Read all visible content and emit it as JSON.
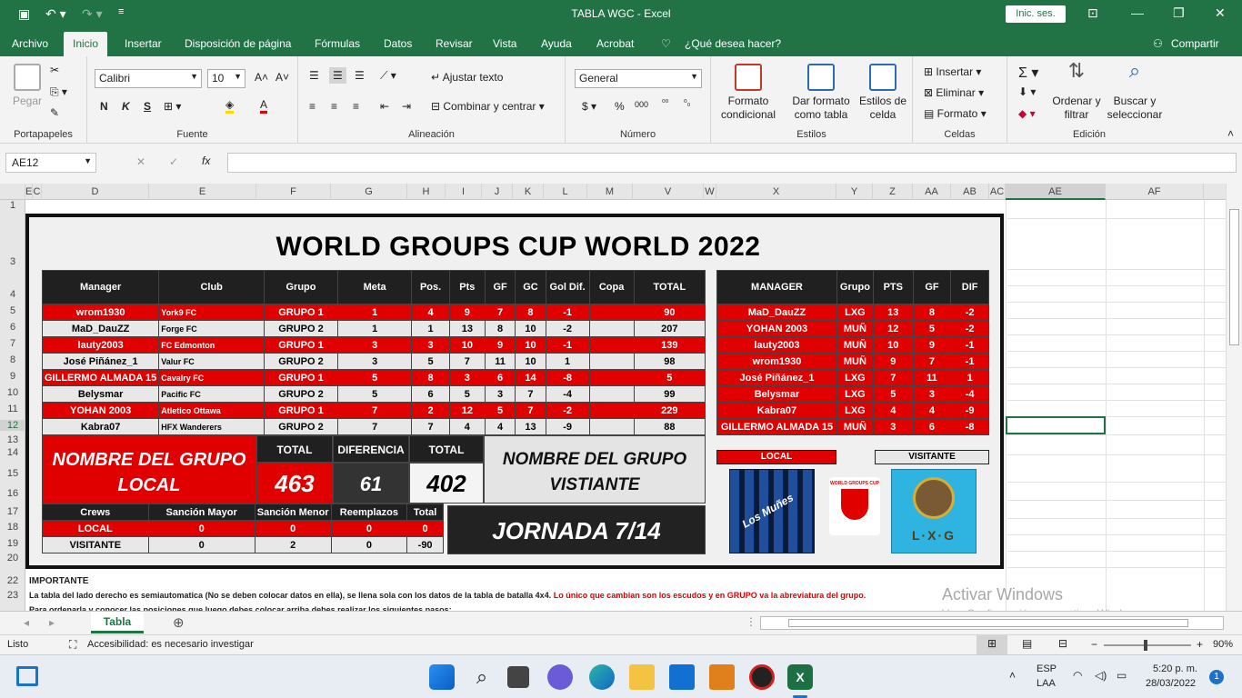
{
  "window": {
    "title": "TABLA WGC  -  Excel",
    "signin": "Inic. ses."
  },
  "menu": [
    "Archivo",
    "Inicio",
    "Insertar",
    "Disposición de página",
    "Fórmulas",
    "Datos",
    "Revisar",
    "Vista",
    "Ayuda",
    "Acrobat",
    "¿Qué desea hacer?"
  ],
  "share": "Compartir",
  "ribbon": {
    "paste": "Pegar",
    "clipboard": "Portapapeles",
    "font_name": "Calibri",
    "font_size": "10",
    "font": "Fuente",
    "wrap": "Ajustar texto",
    "merge": "Combinar y centrar",
    "alignment": "Alineación",
    "number_format": "General",
    "number": "Número",
    "cond_format": "Formato condicional",
    "format_table": "Dar formato como tabla",
    "cell_styles": "Estilos de celda",
    "styles": "Estilos",
    "insert": "Insertar",
    "delete": "Eliminar",
    "format": "Formato",
    "cells": "Celdas",
    "sort": "Ordenar y filtrar",
    "find": "Buscar y seleccionar",
    "editing": "Edición",
    "bold": "N",
    "italic": "K",
    "underline": "S"
  },
  "formula": {
    "namebox": "AE12",
    "fx": "fx"
  },
  "columns": [
    "E",
    "C",
    "D",
    "E",
    "F",
    "G",
    "H",
    "I",
    "J",
    "K",
    "L",
    "M",
    "V",
    "W",
    "X",
    "Y",
    "Z",
    "AA",
    "AB",
    "AC",
    "AE",
    "AF"
  ],
  "rows": [
    "1",
    "3",
    "4",
    "5",
    "6",
    "7",
    "8",
    "9",
    "10",
    "11",
    "12",
    "13",
    "14",
    "15",
    "16",
    "17",
    "18",
    "19",
    "20",
    "22",
    "23"
  ],
  "sheet": {
    "title": "WORLD GROUPS CUP WORLD 2022",
    "headers": [
      "Manager",
      "Club",
      "Grupo",
      "Meta",
      "Pos.",
      "Pts",
      "GF",
      "GC",
      "Gol Dif.",
      "Copa",
      "TOTAL"
    ],
    "rows": [
      [
        "wrom1930",
        "York9 FC",
        "GRUPO 1",
        "1",
        "4",
        "9",
        "7",
        "8",
        "-1",
        "",
        "90"
      ],
      [
        "MaD_DauZZ",
        "Forge FC",
        "GRUPO 2",
        "1",
        "1",
        "13",
        "8",
        "10",
        "-2",
        "",
        "207"
      ],
      [
        "lauty2003",
        "FC Edmonton",
        "GRUPO 1",
        "3",
        "3",
        "10",
        "9",
        "10",
        "-1",
        "",
        "139"
      ],
      [
        "José Piñánez_1",
        "Valur FC",
        "GRUPO 2",
        "3",
        "5",
        "7",
        "11",
        "10",
        "1",
        "",
        "98"
      ],
      [
        "GILLERMO ALMADA 15",
        "Cavalry FC",
        "GRUPO 1",
        "5",
        "8",
        "3",
        "6",
        "14",
        "-8",
        "",
        "5"
      ],
      [
        "Belysmar",
        "Pacific FC",
        "GRUPO 2",
        "5",
        "6",
        "5",
        "3",
        "7",
        "-4",
        "",
        "99"
      ],
      [
        "YOHAN 2003",
        "Atletico Ottawa",
        "GRUPO 1",
        "7",
        "2",
        "12",
        "5",
        "7",
        "-2",
        "",
        "229"
      ],
      [
        "Kabra07",
        "HFX Wanderers",
        "GRUPO 2",
        "7",
        "7",
        "4",
        "4",
        "13",
        "-9",
        "",
        "88"
      ]
    ],
    "right_headers": [
      "MANAGER",
      "Grupo",
      "PTS",
      "GF",
      "DIF"
    ],
    "right_rows": [
      [
        "MaD_DauZZ",
        "LXG",
        "13",
        "8",
        "-2"
      ],
      [
        "YOHAN 2003",
        "MUÑ",
        "12",
        "5",
        "-2"
      ],
      [
        "lauty2003",
        "MUÑ",
        "10",
        "9",
        "-1"
      ],
      [
        "wrom1930",
        "MUÑ",
        "9",
        "7",
        "-1"
      ],
      [
        "José Piñánez_1",
        "LXG",
        "7",
        "11",
        "1"
      ],
      [
        "Belysmar",
        "LXG",
        "5",
        "3",
        "-4"
      ],
      [
        "Kabra07",
        "LXG",
        "4",
        "4",
        "-9"
      ],
      [
        "GILLERMO ALMADA 15",
        "MUÑ",
        "3",
        "6",
        "-8"
      ]
    ],
    "local_name": "NOMBRE DEL GRUPO LOCAL",
    "visit_name": "NOMBRE DEL GRUPO VISTIANTE",
    "total_label": "TOTAL",
    "diff_label": "DIFERENCIA",
    "total_local": "463",
    "difference": "61",
    "total_visit": "402",
    "crews_headers": [
      "Crews",
      "Sanción Mayor",
      "Sanción Menor",
      "Reemplazos",
      "Total"
    ],
    "crews": [
      [
        "LOCAL",
        "0",
        "0",
        "0",
        "0"
      ],
      [
        "VISITANTE",
        "0",
        "2",
        "0",
        "-90"
      ]
    ],
    "jornada": "JORNADA 7/14",
    "local_label": "LOCAL",
    "visit_label": "VISITANTE",
    "logo_left": "Los Muñes",
    "logo_mid": "WORLD GROUPS CUP",
    "logo_right": "L·X·G",
    "note_title": "IMPORTANTE",
    "note_1": "La tabla del lado derecho es semiautomatica (No se deben colocar datos en ella), se llena sola con  los datos de la tabla de batalla 4x4. ",
    "note_1_red": "Lo único que cambian son los escudos y en GRUPO va la abreviatura del grupo.",
    "note_2": "Para ordenarla y conocer las posiciones que luego debes colocar arriba debes realizar los siguientes pasos:"
  },
  "watermark": {
    "line1": "Activar Windows",
    "line2": "Ve a Configuración para activar Windows."
  },
  "tab": "Tabla",
  "status": {
    "ready": "Listo",
    "access": "Accesibilidad: es necesario investigar",
    "zoom": "90%"
  },
  "taskbar": {
    "lang1": "ESP",
    "lang2": "LAA",
    "time": "5:20 p. m.",
    "date": "28/03/2022",
    "badge": "1"
  },
  "colors": {
    "excel_green": "#217346",
    "red": "#e00000",
    "dark": "#202020"
  }
}
